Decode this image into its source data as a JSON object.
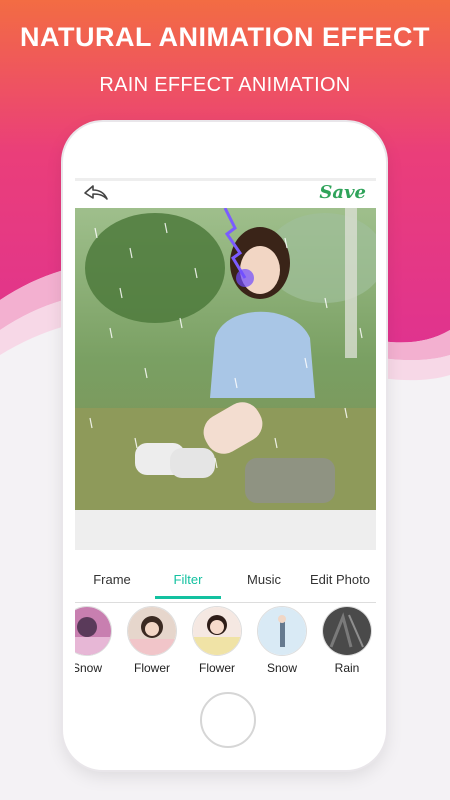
{
  "banner": {
    "headline": "NATURAL ANIMATION EFFECT",
    "subhead": "RAIN EFFECT ANIMATION"
  },
  "editor": {
    "back_icon": "back-arrow-icon",
    "save_label": "Save",
    "tabs": [
      {
        "label": "Frame",
        "active": false
      },
      {
        "label": "Filter",
        "active": true
      },
      {
        "label": "Music",
        "active": false
      },
      {
        "label": "Edit Photo",
        "active": false
      }
    ],
    "effects": [
      {
        "label": "Snow"
      },
      {
        "label": "Flower"
      },
      {
        "label": "Flower"
      },
      {
        "label": "Snow"
      },
      {
        "label": "Rain"
      }
    ]
  },
  "colors": {
    "gradient_top": "#f06b4a",
    "gradient_bottom": "#e8338a",
    "accent": "#13c1a0",
    "save": "#2fa35a"
  }
}
